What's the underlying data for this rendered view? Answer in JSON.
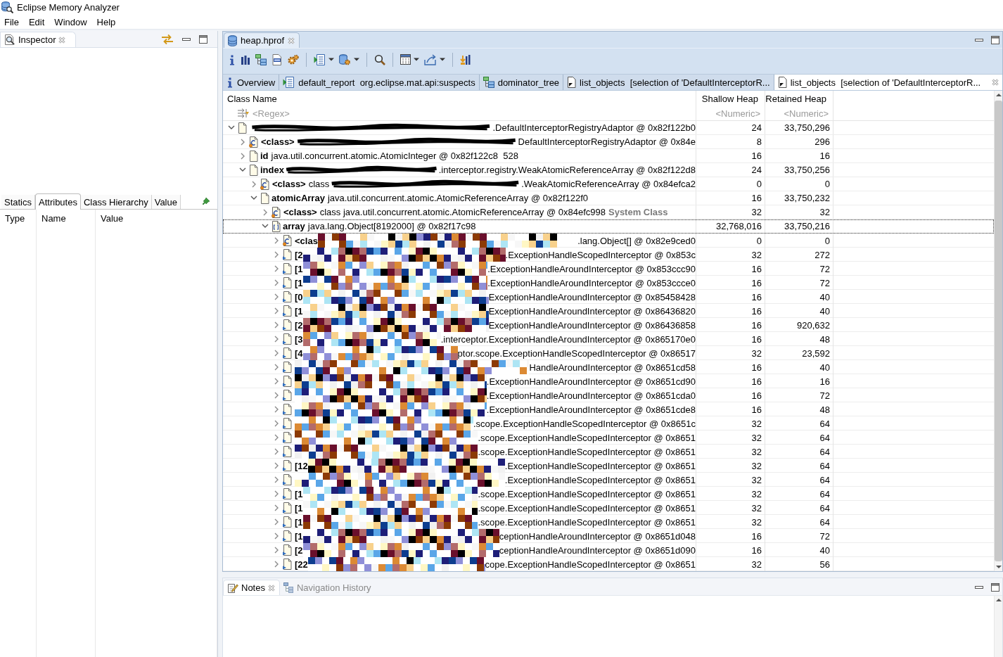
{
  "window": {
    "title": "Eclipse Memory Analyzer"
  },
  "menu": [
    "File",
    "Edit",
    "Window",
    "Help"
  ],
  "inspector": {
    "title": "Inspector",
    "tabs": [
      {
        "label": "Statics",
        "selected": false
      },
      {
        "label": "Attributes",
        "selected": true
      },
      {
        "label": "Class Hierarchy",
        "selected": false
      },
      {
        "label": "Value",
        "selected": false
      }
    ],
    "columns": [
      "Type",
      "Name",
      "Value"
    ]
  },
  "editor": {
    "title": "heap.hprof",
    "result_tabs": [
      {
        "kind": "info",
        "label": "Overview",
        "selected": false
      },
      {
        "kind": "report",
        "label": "default_report  org.eclipse.mat.api:suspects",
        "selected": false
      },
      {
        "kind": "tree",
        "label": "dominator_tree",
        "selected": false
      },
      {
        "kind": "list",
        "label": "list_objects  [selection of 'DefaultInterceptorR...",
        "selected": false
      },
      {
        "kind": "list",
        "label": "list_objects  [selection of 'DefaultInterceptorR...",
        "selected": true
      }
    ],
    "table": {
      "columns": [
        {
          "title": "Class Name",
          "filter": "<Regex>"
        },
        {
          "title": "Shallow Heap",
          "filter": "<Numeric>"
        },
        {
          "title": "Retained Heap",
          "filter": "<Numeric>"
        }
      ],
      "rows": [
        {
          "kind": "object",
          "expanded": true,
          "selected": false,
          "scribbled": true,
          "text": ".DefaultInterceptorRegistryAdaptor @ 0x82f122b0",
          "shallow": "24",
          "retained": "33,750,296",
          "children": [
            {
              "kind": "class",
              "expanded": false,
              "selected": false,
              "name": "<class>",
              "scribbled": true,
              "text": "DefaultInterceptorRegistryAdaptor @ 0x84e",
              "shallow": "8",
              "retained": "296"
            },
            {
              "kind": "object",
              "expanded": false,
              "selected": false,
              "name": "id",
              "scribbled": false,
              "text": "java.util.concurrent.atomic.AtomicInteger @ 0x82f122c8  528",
              "shallow": "16",
              "retained": "16"
            },
            {
              "kind": "object",
              "expanded": true,
              "selected": false,
              "name": "index",
              "scribbled": true,
              "text": ".interceptor.registry.WeakAtomicReferenceArray @ 0x82f122d8",
              "shallow": "24",
              "retained": "33,750,256",
              "children": [
                {
                  "kind": "class",
                  "expanded": false,
                  "selected": false,
                  "name": "<class>",
                  "lead": "class",
                  "scribbled": true,
                  "text": ".WeakAtomicReferenceArray @ 0x84efca2",
                  "shallow": "0",
                  "retained": "0"
                },
                {
                  "kind": "object",
                  "expanded": true,
                  "selected": false,
                  "name": "atomicArray",
                  "scribbled": false,
                  "text": "java.util.concurrent.atomic.AtomicReferenceArray @ 0x82f122f0",
                  "shallow": "16",
                  "retained": "33,750,232",
                  "children": [
                    {
                      "kind": "class",
                      "expanded": false,
                      "selected": false,
                      "name": "<class>",
                      "text": "class java.util.concurrent.atomic.AtomicReferenceArray @ 0x84efc998",
                      "note": "System Class",
                      "shallow": "32",
                      "retained": "32"
                    },
                    {
                      "kind": "array",
                      "expanded": true,
                      "selected": true,
                      "name": "array",
                      "text": "java.lang.Object[8192000] @ 0x82f17c98",
                      "shallow": "32,768,016",
                      "retained": "33,750,216",
                      "children": [
                        {
                          "kind": "class",
                          "expanded": false,
                          "selected": false,
                          "name": "<clas",
                          "pixelated": true,
                          "text": ".lang.Object[] @ 0x82e9ced0",
                          "shallow": "0",
                          "retained": "0"
                        },
                        {
                          "kind": "element",
                          "expanded": false,
                          "selected": false,
                          "name": "[2",
                          "pixelated": true,
                          "text": ".ExceptionHandleScopedInterceptor @ 0x853c",
                          "shallow": "32",
                          "retained": "272"
                        },
                        {
                          "kind": "element",
                          "expanded": false,
                          "selected": false,
                          "name": "[1",
                          "pixelated": true,
                          "text": ".ExceptionHandleAroundInterceptor @ 0x853ccc90",
                          "shallow": "16",
                          "retained": "72"
                        },
                        {
                          "kind": "element",
                          "expanded": false,
                          "selected": false,
                          "name": "[1",
                          "pixelated": true,
                          "text": ".ExceptionHandleAroundInterceptor @ 0x853ccce0",
                          "shallow": "16",
                          "retained": "72"
                        },
                        {
                          "kind": "element",
                          "expanded": false,
                          "selected": false,
                          "name": "[0",
                          "pixelated": true,
                          "text": "ExceptionHandleAroundInterceptor @ 0x85458428",
                          "shallow": "16",
                          "retained": "40"
                        },
                        {
                          "kind": "element",
                          "expanded": false,
                          "selected": false,
                          "name": "[1",
                          "pixelated": true,
                          "text": "ExceptionHandleAroundInterceptor @ 0x86436820",
                          "shallow": "16",
                          "retained": "40"
                        },
                        {
                          "kind": "element",
                          "expanded": false,
                          "selected": false,
                          "name": "[2",
                          "pixelated": true,
                          "text": "ExceptionHandleAroundInterceptor @ 0x86436858",
                          "shallow": "16",
                          "retained": "920,632"
                        },
                        {
                          "kind": "element",
                          "expanded": false,
                          "selected": false,
                          "name": "[3",
                          "pixelated": true,
                          "text": ".interceptor.ExceptionHandleAroundInterceptor @ 0x865170e0",
                          "shallow": "16",
                          "retained": "48"
                        },
                        {
                          "kind": "element",
                          "expanded": false,
                          "selected": false,
                          "name": "[4",
                          "pixelated": true,
                          "text": "ptor.scope.ExceptionHandleScopedInterceptor @ 0x86517",
                          "shallow": "32",
                          "retained": "23,592"
                        },
                        {
                          "kind": "element",
                          "expanded": false,
                          "selected": false,
                          "pixelated": true,
                          "text": "HandleAroundInterceptor @ 0x8651cd58",
                          "shallow": "16",
                          "retained": "40"
                        },
                        {
                          "kind": "element",
                          "expanded": false,
                          "selected": false,
                          "pixelated": true,
                          "text": ".ExceptionHandleAroundInterceptor @ 0x8651cd90",
                          "shallow": "16",
                          "retained": "16"
                        },
                        {
                          "kind": "element",
                          "expanded": false,
                          "selected": false,
                          "pixelated": true,
                          "text": ".ExceptionHandleAroundInterceptor @ 0x8651cda0",
                          "shallow": "16",
                          "retained": "72"
                        },
                        {
                          "kind": "element",
                          "expanded": false,
                          "selected": false,
                          "pixelated": true,
                          "text": ".ExceptionHandleAroundInterceptor @ 0x8651cde8",
                          "shallow": "16",
                          "retained": "48"
                        },
                        {
                          "kind": "element",
                          "expanded": false,
                          "selected": false,
                          "pixelated": true,
                          "text": ".scope.ExceptionHandleScopedInterceptor @ 0x8651c",
                          "shallow": "32",
                          "retained": "64"
                        },
                        {
                          "kind": "element",
                          "expanded": false,
                          "selected": false,
                          "pixelated": true,
                          "text": ".scope.ExceptionHandleScopedInterceptor @ 0x8651",
                          "shallow": "32",
                          "retained": "64"
                        },
                        {
                          "kind": "element",
                          "expanded": false,
                          "selected": false,
                          "pixelated": true,
                          "text": ".scope.ExceptionHandleScopedInterceptor @ 0x8651",
                          "shallow": "32",
                          "retained": "64"
                        },
                        {
                          "kind": "element",
                          "expanded": false,
                          "selected": false,
                          "name": "[12",
                          "pixelated": true,
                          "text": ".ExceptionHandleScopedInterceptor @ 0x8651",
                          "shallow": "32",
                          "retained": "64"
                        },
                        {
                          "kind": "element",
                          "expanded": false,
                          "selected": false,
                          "pixelated": true,
                          "text": ".ExceptionHandleScopedInterceptor @ 0x8651",
                          "shallow": "32",
                          "retained": "64"
                        },
                        {
                          "kind": "element",
                          "expanded": false,
                          "selected": false,
                          "name": "[1",
                          "pixelated": true,
                          "text": ".scope.ExceptionHandleScopedInterceptor @ 0x8651",
                          "shallow": "32",
                          "retained": "64"
                        },
                        {
                          "kind": "element",
                          "expanded": false,
                          "selected": false,
                          "name": "[1",
                          "pixelated": true,
                          "text": ".scope.ExceptionHandleScopedInterceptor @ 0x8651",
                          "shallow": "32",
                          "retained": "64"
                        },
                        {
                          "kind": "element",
                          "expanded": false,
                          "selected": false,
                          "name": "[1",
                          "pixelated": true,
                          "text": ".scope.ExceptionHandleScopedInterceptor @ 0x8651",
                          "shallow": "32",
                          "retained": "64"
                        },
                        {
                          "kind": "element",
                          "expanded": false,
                          "selected": false,
                          "name": "[1",
                          "pixelated": true,
                          "text": "ceptionHandleAroundInterceptor @ 0x8651d048",
                          "shallow": "16",
                          "retained": "72"
                        },
                        {
                          "kind": "element",
                          "expanded": false,
                          "selected": false,
                          "name": "[2",
                          "pixelated": true,
                          "text": "ceptionHandleAroundInterceptor @ 0x8651d090",
                          "shallow": "16",
                          "retained": "40"
                        },
                        {
                          "kind": "element",
                          "expanded": false,
                          "selected": false,
                          "name": "[22",
                          "pixelated": true,
                          "text": "cope.ExceptionHandleScopedInterceptor @ 0x8651",
                          "shallow": "32",
                          "retained": "56"
                        }
                      ]
                    }
                  ]
                }
              ]
            }
          ]
        }
      ]
    }
  },
  "bottom_tabs": [
    {
      "label": "Notes",
      "selected": true
    },
    {
      "label": "Navigation History",
      "selected": false
    }
  ]
}
